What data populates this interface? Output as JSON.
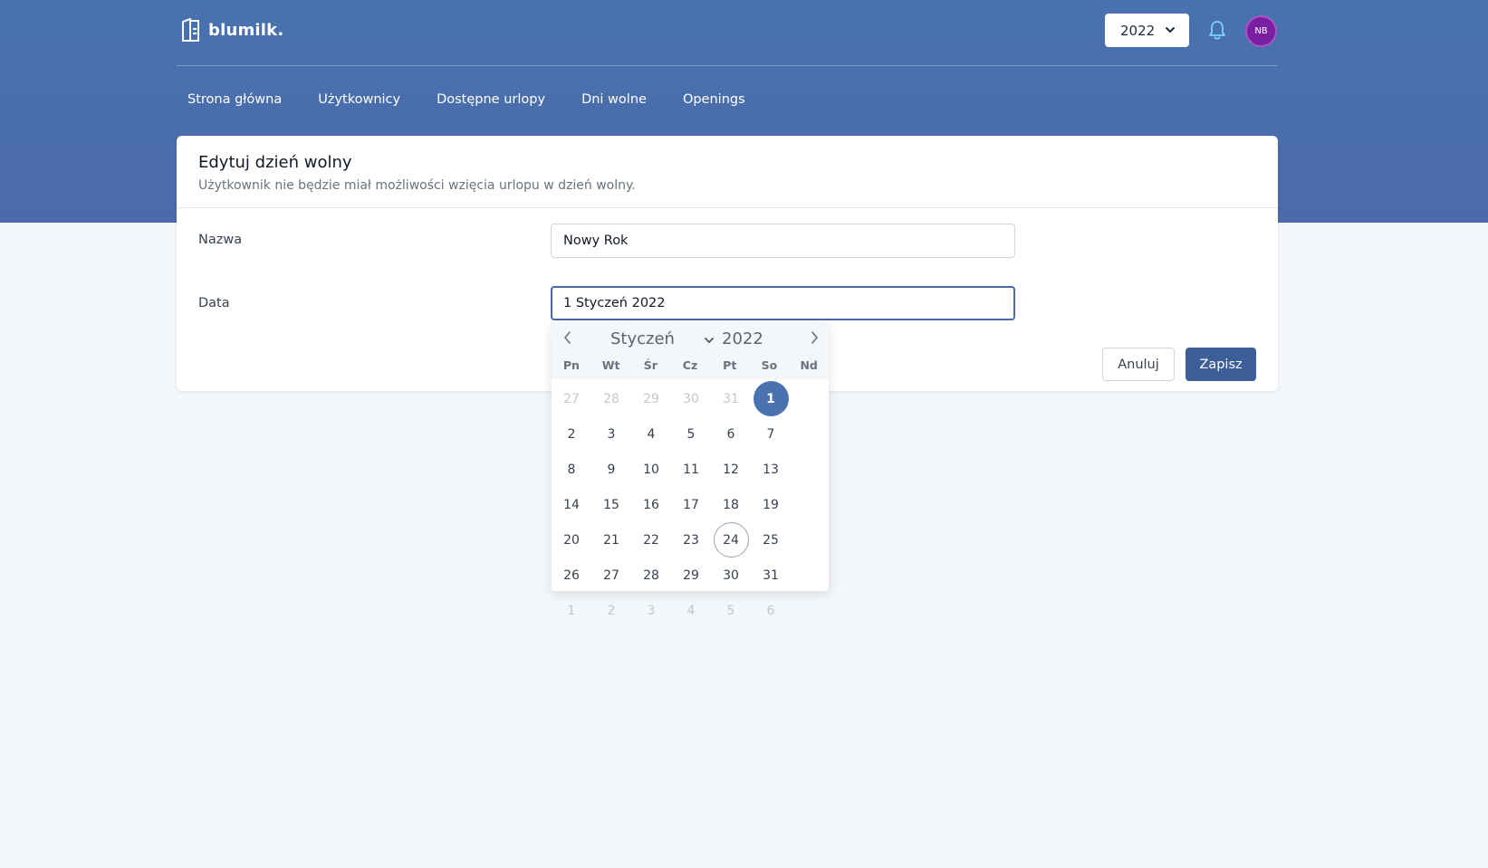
{
  "app": {
    "logo_text": "blumilk.",
    "year_select": "2022",
    "avatar_initials": "NB"
  },
  "nav": {
    "items": [
      {
        "label": "Strona główna"
      },
      {
        "label": "Użytkownicy"
      },
      {
        "label": "Dostępne urlopy"
      },
      {
        "label": "Dni wolne"
      },
      {
        "label": "Openings"
      }
    ]
  },
  "form": {
    "title": "Edytuj dzień wolny",
    "subtitle": "Użytkownik nie będzie miał możliwości wzięcia urlopu w dzień wolny.",
    "name_label": "Nazwa",
    "name_value": "Nowy Rok",
    "date_label": "Data",
    "date_value": "1 Styczeń 2022",
    "cancel_label": "Anuluj",
    "save_label": "Zapisz"
  },
  "calendar": {
    "month": "Styczeń",
    "year": "2022",
    "weekdays": [
      "Pn",
      "Wt",
      "Śr",
      "Cz",
      "Pt",
      "So",
      "Nd"
    ],
    "days": [
      {
        "d": "27",
        "muted": true
      },
      {
        "d": "28",
        "muted": true
      },
      {
        "d": "29",
        "muted": true
      },
      {
        "d": "30",
        "muted": true
      },
      {
        "d": "31",
        "muted": true
      },
      {
        "d": "1",
        "selected": true
      },
      {
        "d": "2"
      },
      {
        "d": "3"
      },
      {
        "d": "4"
      },
      {
        "d": "5"
      },
      {
        "d": "6"
      },
      {
        "d": "7"
      },
      {
        "d": "8"
      },
      {
        "d": "9"
      },
      {
        "d": "10"
      },
      {
        "d": "11"
      },
      {
        "d": "12"
      },
      {
        "d": "13"
      },
      {
        "d": "14"
      },
      {
        "d": "15"
      },
      {
        "d": "16"
      },
      {
        "d": "17"
      },
      {
        "d": "18"
      },
      {
        "d": "19"
      },
      {
        "d": "20"
      },
      {
        "d": "21"
      },
      {
        "d": "22"
      },
      {
        "d": "23"
      },
      {
        "d": "24",
        "today": true
      },
      {
        "d": "25"
      },
      {
        "d": "26"
      },
      {
        "d": "27"
      },
      {
        "d": "28"
      },
      {
        "d": "29"
      },
      {
        "d": "30"
      },
      {
        "d": "31"
      },
      {
        "d": "1",
        "muted": true
      },
      {
        "d": "2",
        "muted": true
      },
      {
        "d": "3",
        "muted": true
      },
      {
        "d": "4",
        "muted": true
      },
      {
        "d": "5",
        "muted": true
      },
      {
        "d": "6",
        "muted": true
      }
    ]
  },
  "colors": {
    "header_bg": "#4a72b0",
    "primary_button": "#3d5f99",
    "avatar_bg": "#7b1fa2",
    "selected_day": "#4a72b0"
  },
  "icons": {
    "logo": "blumilk-logo-icon",
    "bell": "bell-icon",
    "year_chevron": "chevron-down-icon",
    "prev_month": "chevron-left-icon",
    "next_month": "chevron-right-icon"
  }
}
